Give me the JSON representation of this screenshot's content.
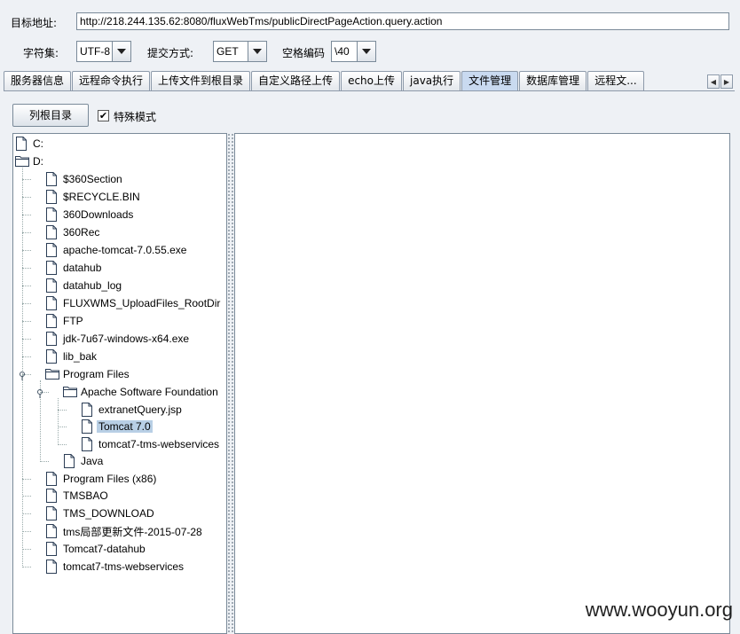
{
  "toolbar": {
    "target_label": "目标地址:",
    "target_url": "http://218.244.135.62:8080/fluxWebTms/publicDirectPageAction.query.action",
    "charset_label": "字符集:",
    "charset_value": "UTF-8",
    "method_label": "提交方式:",
    "method_value": "GET",
    "space_label": "空格编码",
    "space_value": "\\40"
  },
  "tabs": [
    {
      "label": "服务器信息"
    },
    {
      "label": "远程命令执行"
    },
    {
      "label": "上传文件到根目录"
    },
    {
      "label": "自定义路径上传"
    },
    {
      "label": "echo上传"
    },
    {
      "label": "java执行"
    },
    {
      "label": "文件管理",
      "active": true
    },
    {
      "label": "数据库管理"
    },
    {
      "label": "远程文..."
    }
  ],
  "file_manager": {
    "list_root_button": "列根目录",
    "special_mode_label": "特殊模式",
    "special_mode_checked": true,
    "check_mark": "✔"
  },
  "tree": [
    {
      "label": "C:",
      "depth": 0,
      "icon": "file-icon"
    },
    {
      "label": "D:",
      "depth": 0,
      "icon": "folder-open-icon"
    },
    {
      "label": "$360Section",
      "depth": 1,
      "icon": "file-icon"
    },
    {
      "label": "$RECYCLE.BIN",
      "depth": 1,
      "icon": "file-icon"
    },
    {
      "label": "360Downloads",
      "depth": 1,
      "icon": "file-icon"
    },
    {
      "label": "360Rec",
      "depth": 1,
      "icon": "file-icon"
    },
    {
      "label": "apache-tomcat-7.0.55.exe",
      "depth": 1,
      "icon": "file-icon"
    },
    {
      "label": "datahub",
      "depth": 1,
      "icon": "file-icon"
    },
    {
      "label": "datahub_log",
      "depth": 1,
      "icon": "file-icon"
    },
    {
      "label": "FLUXWMS_UploadFiles_RootDir",
      "depth": 1,
      "icon": "file-icon"
    },
    {
      "label": "FTP",
      "depth": 1,
      "icon": "file-icon"
    },
    {
      "label": "jdk-7u67-windows-x64.exe",
      "depth": 1,
      "icon": "file-icon"
    },
    {
      "label": "lib_bak",
      "depth": 1,
      "icon": "file-icon"
    },
    {
      "label": "Program Files",
      "depth": 1,
      "icon": "folder-open-icon"
    },
    {
      "label": "Apache Software Foundation",
      "depth": 2,
      "icon": "folder-open-icon"
    },
    {
      "label": "extranetQuery.jsp",
      "depth": 3,
      "icon": "file-icon"
    },
    {
      "label": "Tomcat 7.0",
      "depth": 3,
      "icon": "file-icon",
      "selected": true
    },
    {
      "label": "tomcat7-tms-webservices",
      "depth": 3,
      "icon": "file-icon"
    },
    {
      "label": "Java",
      "depth": 2,
      "icon": "file-icon"
    },
    {
      "label": "Program Files (x86)",
      "depth": 1,
      "icon": "file-icon"
    },
    {
      "label": "TMSBAO",
      "depth": 1,
      "icon": "file-icon"
    },
    {
      "label": "TMS_DOWNLOAD",
      "depth": 1,
      "icon": "file-icon"
    },
    {
      "label": "tms局部更新文件-2015-07-28",
      "depth": 1,
      "icon": "file-icon"
    },
    {
      "label": "Tomcat7-datahub",
      "depth": 1,
      "icon": "file-icon"
    },
    {
      "label": "tomcat7-tms-webservices",
      "depth": 1,
      "icon": "file-icon"
    }
  ],
  "watermark": "www.wooyun.org"
}
